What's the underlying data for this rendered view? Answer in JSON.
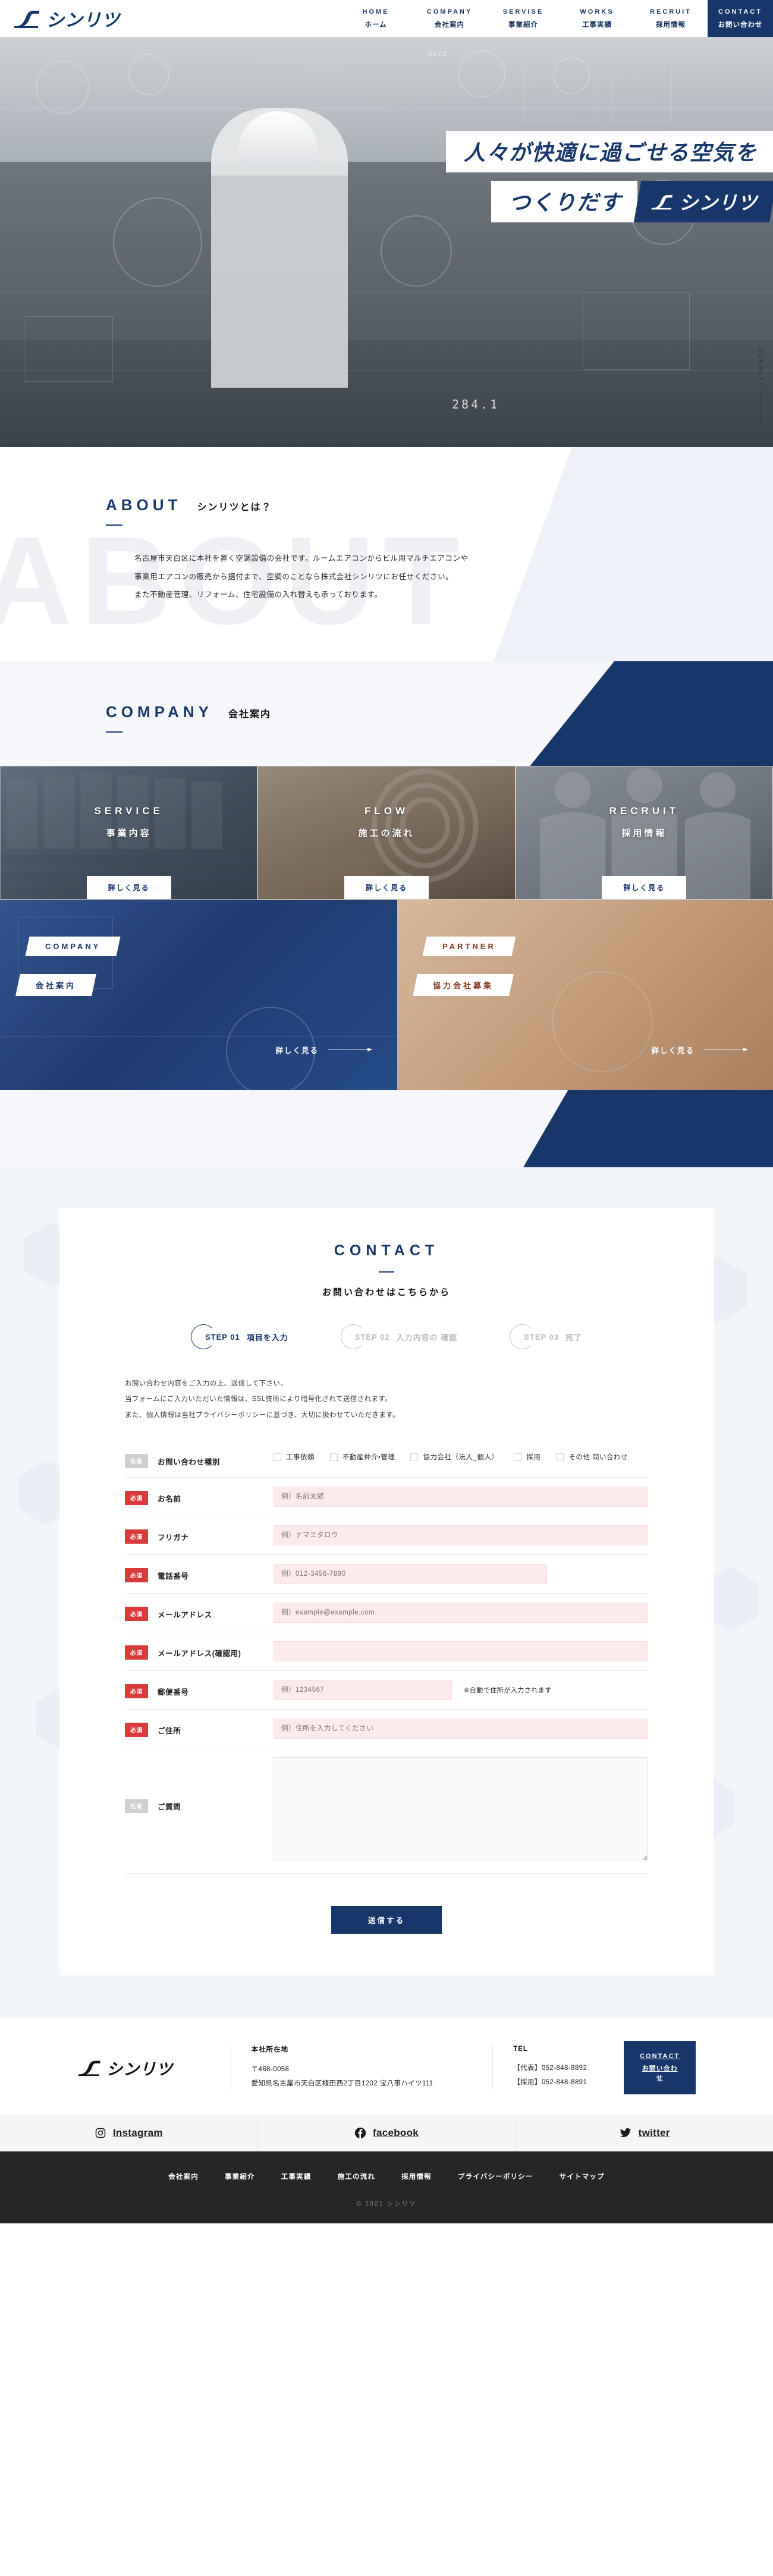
{
  "brand": {
    "name": "シンリツ",
    "logo_icon": "shinritsu-logo-icon",
    "accent": "#17376a",
    "required_color": "#d93a3a"
  },
  "nav": {
    "items": [
      {
        "en": "HOME",
        "ja": "ホーム"
      },
      {
        "en": "COMPANY",
        "ja": "会社案内"
      },
      {
        "en": "SERVISE",
        "ja": "事業紹介"
      },
      {
        "en": "WORKS",
        "ja": "工事実績"
      },
      {
        "en": "RECRUIT",
        "ja": "採用情報"
      },
      {
        "en": "CONTACT",
        "ja": "お問い合わせ"
      }
    ]
  },
  "hero": {
    "line1": "人々が快適に過ごせる空気を",
    "line2": "つくりだす",
    "logo_label": "シンリツ",
    "scroll_label": "SCROLL",
    "badge": "AACC",
    "number": "284.1"
  },
  "about": {
    "en": "ABOUT",
    "ja": "シンリツとは？",
    "ghost": "ABOUT",
    "p1": "名古屋市天白区に本社を置く空調設備の会社です。ルームエアコンからビル用マルチエアコンや",
    "p2": "事業用エアコンの販売から据付まで、空調のことなら株式会社シンリツにお任せください。",
    "p3": "また不動産管理、リフォーム、住宅設備の入れ替えも承っております。"
  },
  "company": {
    "en": "COMPANY",
    "ja": "会社案内",
    "cards": [
      {
        "en": "SERVICE",
        "ja": "事業内容",
        "more": "詳しく見る"
      },
      {
        "en": "FLOW",
        "ja": "施工の流れ",
        "more": "詳しく見る"
      },
      {
        "en": "RECRUIT",
        "ja": "採用情報",
        "more": "詳しく見る"
      }
    ],
    "banners": [
      {
        "en": "COMPANY",
        "ja": "会社案内",
        "more": "詳しく見る"
      },
      {
        "en": "PARTNER",
        "ja": "協力会社募集",
        "more": "詳しく見る"
      }
    ]
  },
  "contact": {
    "en": "CONTACT",
    "ja": "お問い合わせはこちらから",
    "steps": [
      {
        "no": "STEP 01",
        "label": "項目を入力",
        "active": true
      },
      {
        "no": "STEP 02",
        "label": "入力内容の 確認",
        "active": false
      },
      {
        "no": "STEP 03",
        "label": "完了",
        "active": false
      }
    ],
    "note1": "お問い合わせ内容をご入力の上、送信して下さい。",
    "note2": "当フォームにご入力いただいた情報は、SSL技術により暗号化されて送信されます。",
    "note3": "また、個人情報は当社プライバシーポリシーに基づき、大切に扱わせていただきます。",
    "badge_required": "必須",
    "badge_optional": "任意",
    "fields": {
      "type": {
        "label": "お問い合わせ種別",
        "options": [
          "工事依頼",
          "不動産仲介・管理",
          "協力会社（法人_個人）",
          "採用",
          "その他 問い合わせ"
        ]
      },
      "name": {
        "label": "お名前",
        "placeholder": "例）名前太郎",
        "value": ""
      },
      "furigana": {
        "label": "フリガナ",
        "placeholder": "例）ナマエタロウ",
        "value": ""
      },
      "tel": {
        "label": "電話番号",
        "placeholder": "例）012-3456-7890",
        "value": ""
      },
      "email": {
        "label": "メールアドレス",
        "placeholder": "例）example@example.com",
        "value": ""
      },
      "email_confirm": {
        "label": "メールアドレス(確認用)",
        "placeholder": "",
        "value": ""
      },
      "postal": {
        "label": "郵便番号",
        "placeholder": "例）1234567",
        "value": "",
        "hint": "※自動で住所が入力されます"
      },
      "address": {
        "label": "ご住所",
        "placeholder": "例）住所を入力してください",
        "value": ""
      },
      "question": {
        "label": "ご質問",
        "placeholder": "",
        "value": ""
      }
    },
    "submit": "送信する"
  },
  "footer": {
    "address_head": "本社所在地",
    "postal": "〒468-0058",
    "address": "愛知県名古屋市天白区植田西2丁目1202 宝八事ハイツ111",
    "tel_head": "TEL",
    "tel_main": "【代表】052-848-8892",
    "tel_recruit": "【採用】052-848-8891",
    "cta_en": "CONTACT",
    "cta_ja": "お問い合わせ",
    "social": [
      {
        "name": "Instagram",
        "icon": "instagram-icon"
      },
      {
        "name": "facebook",
        "icon": "facebook-icon"
      },
      {
        "name": "twitter",
        "icon": "twitter-icon"
      }
    ],
    "links": [
      "会社案内",
      "事業紹介",
      "工事実績",
      "施工の流れ",
      "採用情報",
      "プライバシーポリシー",
      "サイトマップ"
    ],
    "copyright": "© 2021 シンリツ"
  }
}
